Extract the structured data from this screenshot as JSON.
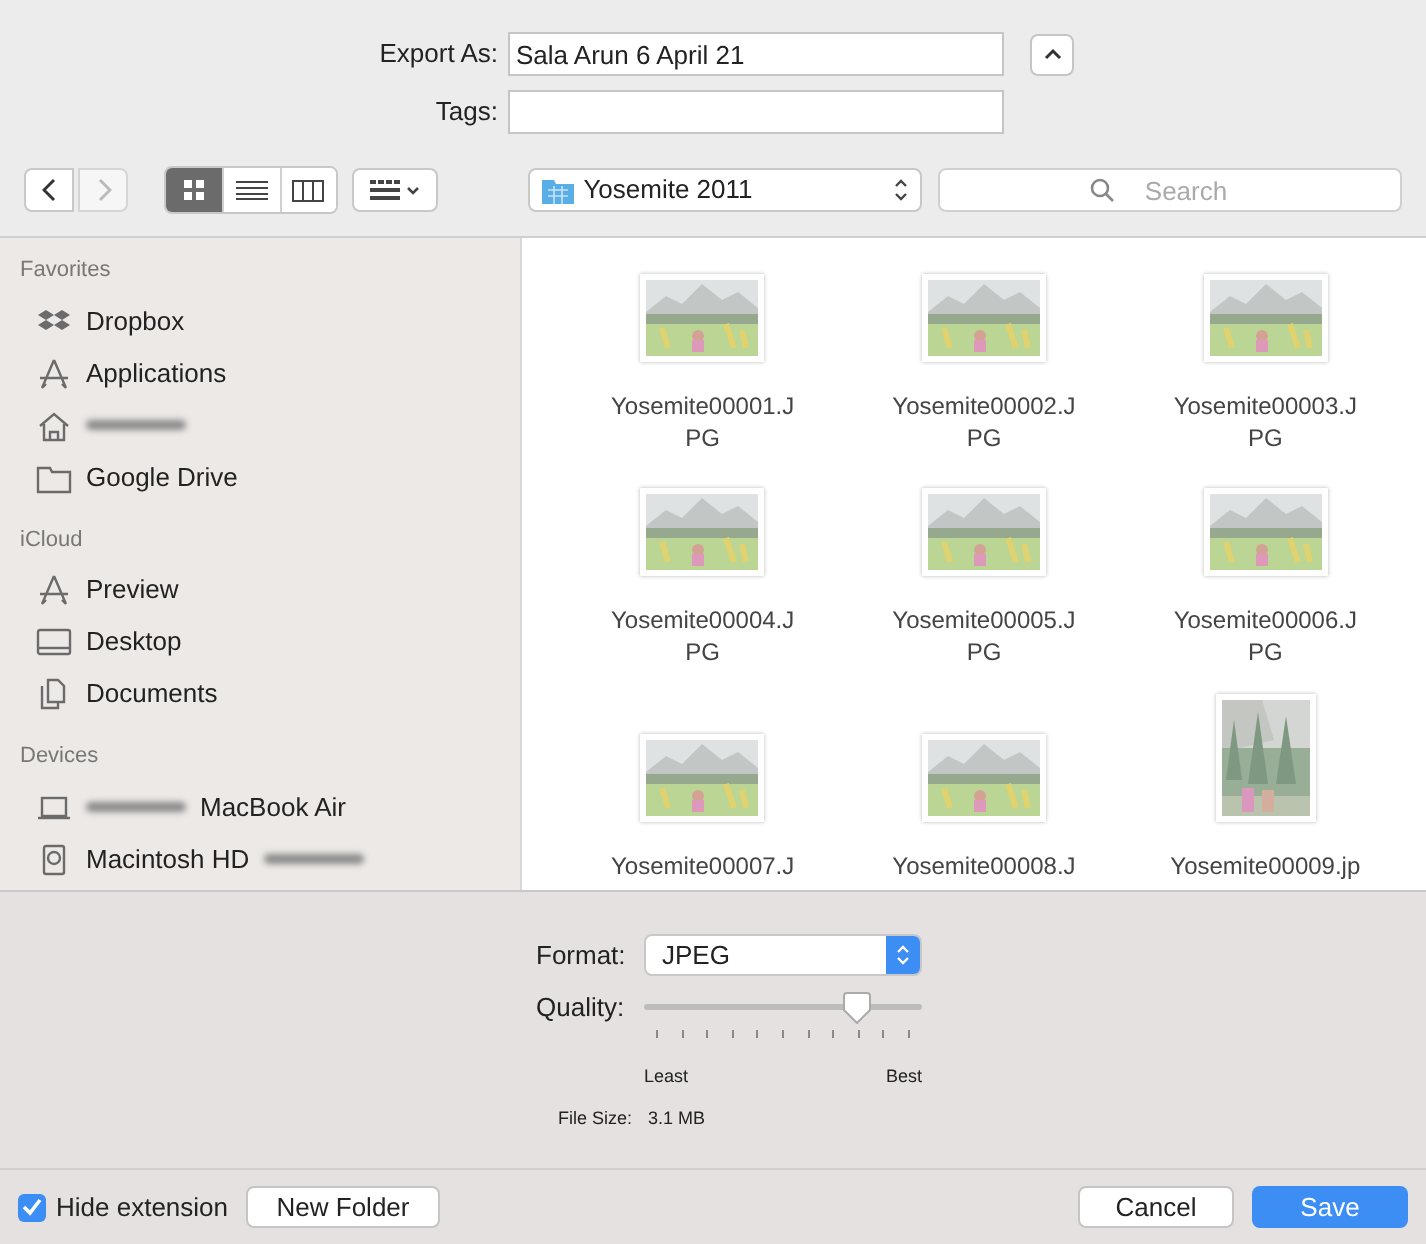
{
  "export_as": {
    "label": "Export As:",
    "value": "Sala Arun 6 April 21",
    "expanded": true
  },
  "tags": {
    "label": "Tags:"
  },
  "toolbar": {
    "views": [
      {
        "kind": "icons",
        "selected": true
      },
      {
        "kind": "list",
        "selected": false
      },
      {
        "kind": "columns",
        "selected": false
      }
    ],
    "location": "Yosemite 2011",
    "search": {
      "placeholder": "Search"
    }
  },
  "sidebar": [
    {
      "title": "Favorites",
      "items": [
        {
          "kind": "dropbox",
          "label": "Dropbox"
        },
        {
          "kind": "apps",
          "label": "Applications"
        },
        {
          "kind": "home",
          "blurred": true
        },
        {
          "kind": "folder",
          "label": "Google Drive"
        }
      ]
    },
    {
      "title": "iCloud",
      "items": [
        {
          "kind": "apps",
          "label": "Preview"
        },
        {
          "kind": "desktop",
          "label": "Desktop"
        },
        {
          "kind": "docs",
          "label": "Documents"
        }
      ]
    },
    {
      "title": "Devices",
      "items": [
        {
          "kind": "laptop",
          "label": "MacBook Air",
          "blurred": true
        },
        {
          "kind": "disk",
          "label": "Macintosh HD",
          "blurred_after": true
        }
      ]
    }
  ],
  "files": [
    {
      "name": "Yosemite00001.JPG",
      "kind": "landscape"
    },
    {
      "name": "Yosemite00002.JPG",
      "kind": "landscape"
    },
    {
      "name": "Yosemite00003.JPG",
      "kind": "landscape"
    },
    {
      "name": "Yosemite00004.JPG",
      "kind": "landscape"
    },
    {
      "name": "Yosemite00005.JPG",
      "kind": "landscape"
    },
    {
      "name": "Yosemite00006.JPG",
      "kind": "landscape"
    },
    {
      "name": "Yosemite00007.J",
      "kind": "landscape"
    },
    {
      "name": "Yosemite00008.J",
      "kind": "landscape"
    },
    {
      "name": "Yosemite00009.jp",
      "kind": "portrait"
    }
  ],
  "format": {
    "label": "Format:",
    "value": "JPEG"
  },
  "quality": {
    "label": "Quality:",
    "level": 0.77,
    "min_label": "Least",
    "max_label": "Best"
  },
  "file_size": {
    "label": "File Size:",
    "value": "3.1 MB"
  },
  "hide_extension": {
    "label": "Hide extension",
    "checked": true
  },
  "buttons": {
    "new_folder": "New Folder",
    "cancel": "Cancel",
    "save": "Save"
  }
}
